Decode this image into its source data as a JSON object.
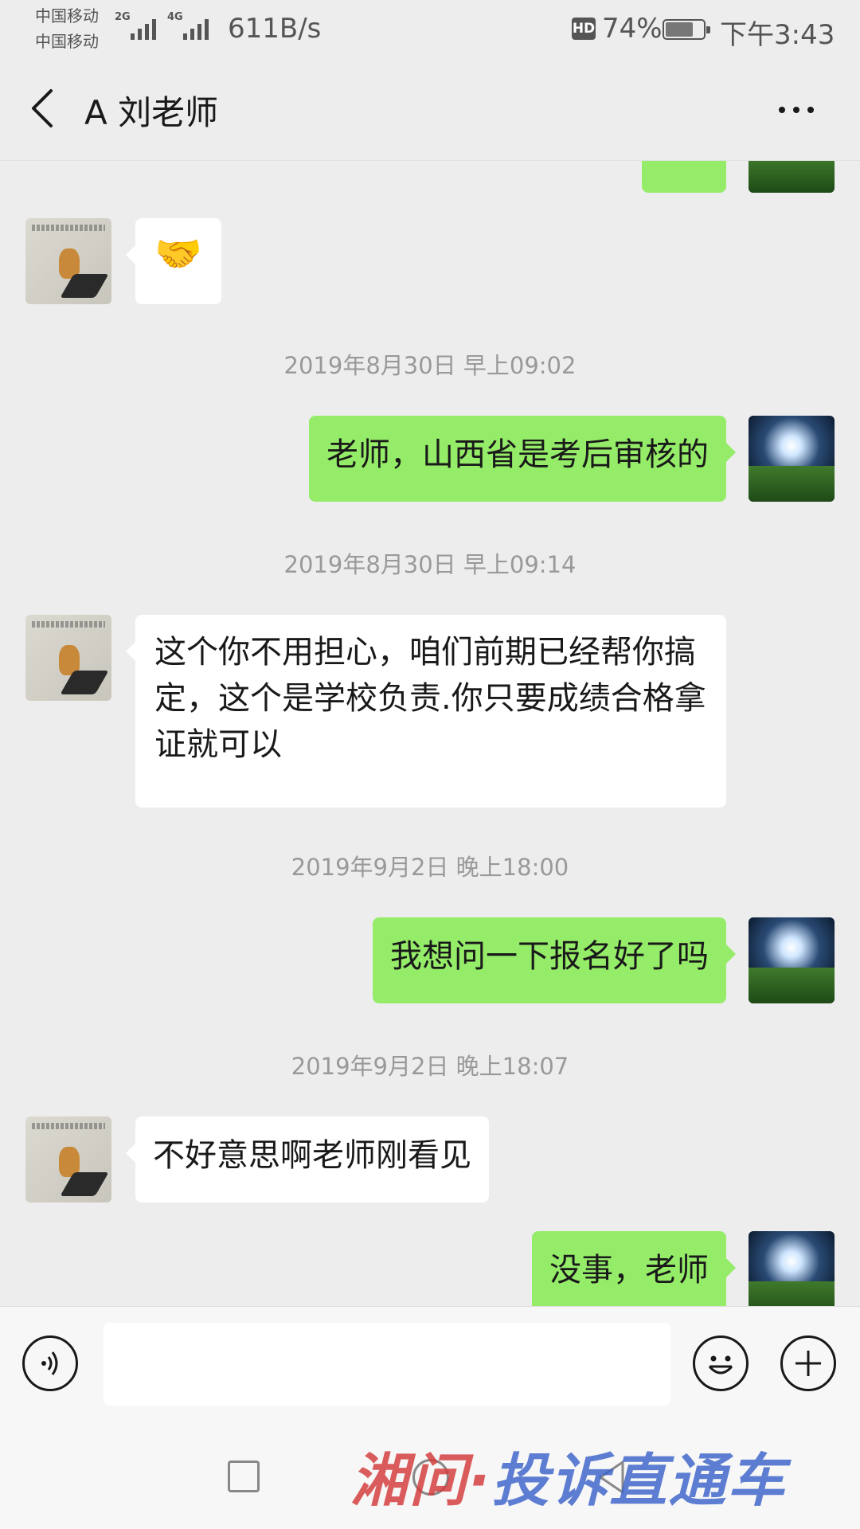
{
  "status_bar": {
    "carrier_1": "中国移动",
    "carrier_2": "中国移动",
    "net_1": "2G",
    "net_2": "4G",
    "speed": "611B/s",
    "hd": "HD",
    "battery_pct": "74%",
    "battery_level": 0.74,
    "time": "下午3:43"
  },
  "header": {
    "title": "A 刘老师"
  },
  "messages": [
    {
      "side": "out",
      "type": "image-partial"
    },
    {
      "side": "in",
      "type": "emoji",
      "text": "🤝"
    },
    {
      "type": "timestamp",
      "text": "2019年8月30日 早上09:02"
    },
    {
      "side": "out",
      "text": "老师，山西省是考后审核的"
    },
    {
      "type": "timestamp",
      "text": "2019年8月30日 早上09:14"
    },
    {
      "side": "in",
      "text": "这个你不用担心，咱们前期已经帮你搞定，这个是学校负责.你只要成绩合格拿证就可以"
    },
    {
      "type": "timestamp",
      "text": "2019年9月2日 晚上18:00"
    },
    {
      "side": "out",
      "text": "我想问一下报名好了吗"
    },
    {
      "type": "timestamp",
      "text": "2019年9月2日 晚上18:07"
    },
    {
      "side": "in",
      "text": "不好意思啊老师刚看见"
    },
    {
      "side": "out",
      "text": "没事，老师"
    }
  ],
  "input": {
    "value": ""
  },
  "watermark": {
    "red": "湘问·",
    "blue": "投诉直通车"
  },
  "colors": {
    "background": "#ededed",
    "outgoing_bubble": "#95ec69",
    "incoming_bubble": "#ffffff",
    "watermark_red": "#d43a3a",
    "watermark_blue": "#3b63c9"
  }
}
